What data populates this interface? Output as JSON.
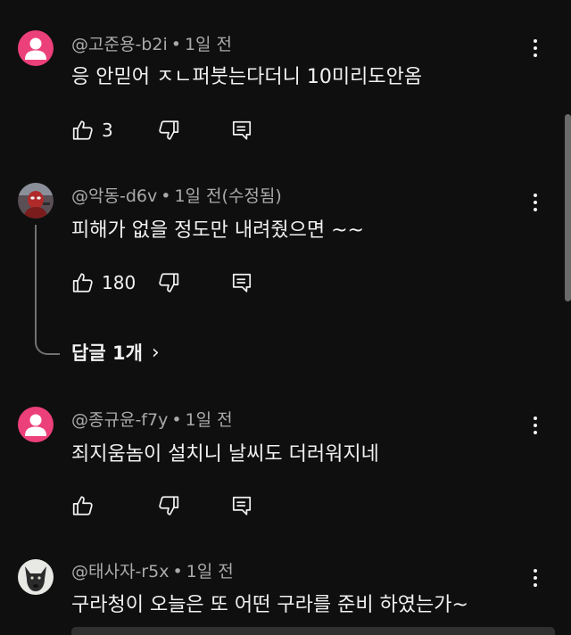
{
  "colors": {
    "background": "#0f0f0f",
    "text_primary": "#f1f1f1",
    "text_secondary": "#aaaaaa",
    "avatar_pink": "#ec407a",
    "thread_line": "#717171"
  },
  "separator": "•",
  "comments": [
    {
      "author": "@고준용-b2i",
      "time": "1일 전",
      "text": "응 안믿어 ㅈㄴ퍼붓는다더니 10미리도안옴",
      "likes": "3",
      "avatar": "default-avatar-icon"
    },
    {
      "author": "@악동-d6v",
      "time": "1일 전(수정됨)",
      "text": "피해가 없을 정도만 내려줬으면 ~~",
      "likes": "180",
      "avatar": "illustrated-character-avatar",
      "replies_label": "답글 1개",
      "replies_chevron": "›"
    },
    {
      "author": "@종규윤-f7y",
      "time": "1일 전",
      "text": "죄지움놈이 설치니 날씨도 더러워지네",
      "likes": "",
      "avatar": "default-avatar-icon"
    },
    {
      "author": "@태사자-r5x",
      "time": "1일 전",
      "text": "구라청이 오늘은 또 어떤 구라를 준비 하였는가~",
      "likes": "",
      "avatar": "dog-photo-avatar"
    }
  ],
  "icons": {
    "like": "thumbs-up-icon",
    "dislike": "thumbs-down-icon",
    "reply": "reply-comment-icon",
    "more": "more-vertical-icon"
  }
}
